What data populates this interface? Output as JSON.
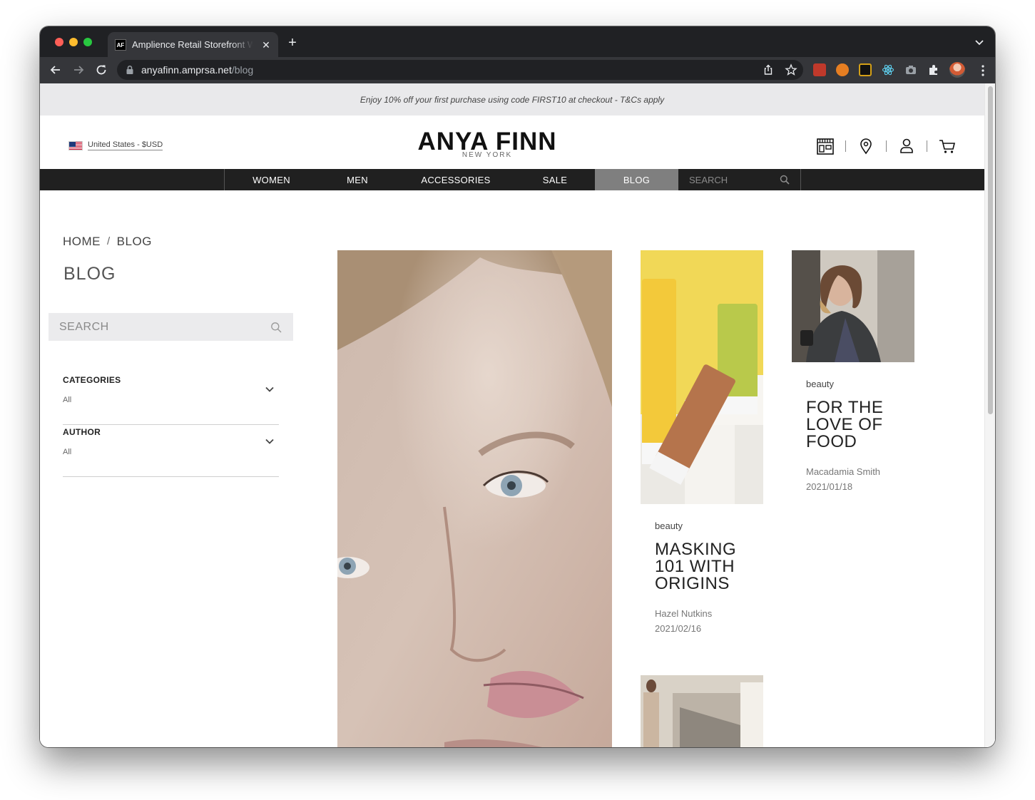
{
  "browser": {
    "tab_title": "Amplience Retail Storefront Website",
    "tab_favicon": "AF",
    "url_host": "anyafinn.amprsa.net",
    "url_path": "/blog",
    "new_tab_symbol": "+",
    "tab_close_symbol": "✕"
  },
  "promo": {
    "text": "Enjoy 10% off your first purchase using code FIRST10 at checkout - T&Cs apply"
  },
  "header": {
    "locale": "United States - $USD",
    "logo_main": "ANYA FINN",
    "logo_sub": "NEW YORK",
    "icons": [
      "store-icon",
      "location-pin-icon",
      "account-icon",
      "cart-icon"
    ]
  },
  "nav": {
    "items": [
      {
        "label": "WOMEN"
      },
      {
        "label": "MEN"
      },
      {
        "label": "ACCESSORIES"
      },
      {
        "label": "SALE"
      },
      {
        "label": "BLOG",
        "active": true
      }
    ],
    "search_placeholder": "SEARCH"
  },
  "breadcrumb": {
    "home": "HOME",
    "separator": "/",
    "current": "BLOG"
  },
  "page_title": "BLOG",
  "sidebar": {
    "search_placeholder": "SEARCH",
    "filters": [
      {
        "title": "CATEGORIES",
        "value": "All"
      },
      {
        "title": "AUTHOR",
        "value": "All"
      }
    ]
  },
  "posts": [
    {
      "category": "beauty",
      "title": "MASKING 101 WITH ORIGINS",
      "author": "Hazel Nutkins",
      "date": "2021/02/16"
    },
    {
      "category": "beauty",
      "title": "FOR THE LOVE OF FOOD",
      "author": "Macadamia Smith",
      "date": "2021/01/18"
    }
  ],
  "colors": {
    "nav_bg": "#202020",
    "nav_active": "#7f7f7f",
    "promo_bg": "#e9e9eb",
    "sidebar_search_bg": "#ebebed"
  }
}
